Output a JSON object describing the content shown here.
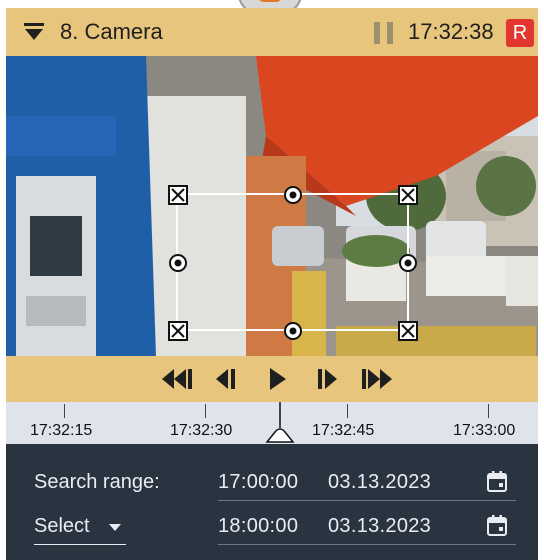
{
  "header": {
    "title": "8. Camera",
    "time": "17:32:38",
    "record_badge": "R",
    "collapse_icon": "chevron-down-icon",
    "pause_icon": "pause-icon"
  },
  "controls": {
    "buttons": [
      "skip-back-icon",
      "step-back-icon",
      "play-icon",
      "step-forward-icon",
      "skip-forward-icon"
    ]
  },
  "timeline": {
    "labels": [
      "17:32:15",
      "17:32:30",
      "17:32:45",
      "17:33:00"
    ]
  },
  "search": {
    "range_label": "Search range:",
    "select_label": "Select",
    "start_time": "17:00:00",
    "start_date": "03.13.2023",
    "end_time": "18:00:00",
    "end_date": "03.13.2023",
    "calendar_icon": "calendar-icon"
  },
  "colors": {
    "header_bg": "#e8c57c",
    "panel_bg": "#2a3441",
    "record_red": "#e2362f",
    "timeline_bg": "#dfe4ec"
  }
}
